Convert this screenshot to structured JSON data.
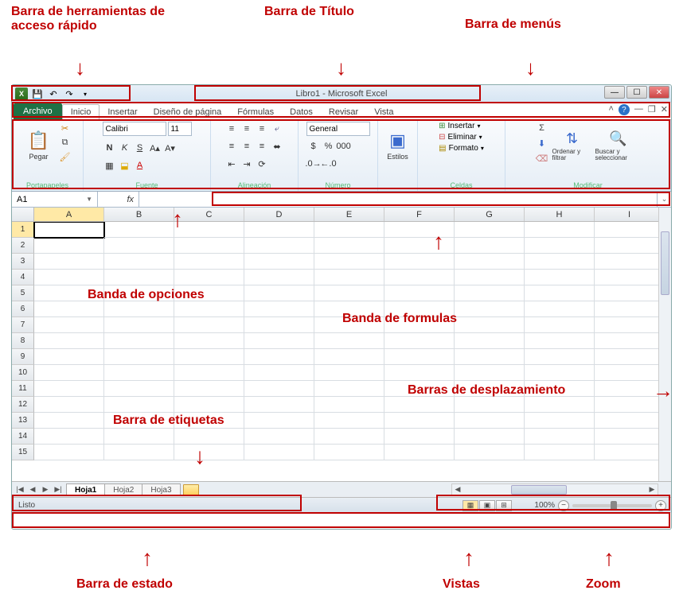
{
  "annotations": {
    "qat": "Barra de herramientas de acceso rápido",
    "title": "Barra de Título",
    "menus": "Barra de menús",
    "ribbon": "Banda de opciones",
    "formula": "Banda de formulas",
    "scroll": "Barras de desplazamiento",
    "tabs": "Barra de etiquetas",
    "status": "Barra de estado",
    "views": "Vistas",
    "zoom": "Zoom"
  },
  "titlebar": {
    "title": "Libro1  -  Microsoft Excel"
  },
  "menubar": {
    "file": "Archivo",
    "tabs": [
      "Inicio",
      "Insertar",
      "Diseño de página",
      "Fórmulas",
      "Datos",
      "Revisar",
      "Vista"
    ]
  },
  "ribbon": {
    "clipboard": {
      "label": "Portapapeles",
      "paste": "Pegar"
    },
    "font": {
      "label": "Fuente",
      "name": "Calibri",
      "size": "11"
    },
    "alignment": {
      "label": "Alineación"
    },
    "number": {
      "label": "Número",
      "format": "General"
    },
    "styles": {
      "label": "",
      "btn": "Estilos"
    },
    "cells": {
      "label": "Celdas",
      "insert": "Insertar",
      "delete": "Eliminar",
      "format": "Formato"
    },
    "editing": {
      "label": "Modificar",
      "sort": "Ordenar y filtrar",
      "find": "Buscar y seleccionar"
    }
  },
  "namebox": "A1",
  "fx": "fx",
  "columns": [
    "A",
    "B",
    "C",
    "D",
    "E",
    "F",
    "G",
    "H",
    "I"
  ],
  "rows": [
    "1",
    "2",
    "3",
    "4",
    "5",
    "6",
    "7",
    "8",
    "9",
    "10",
    "11",
    "12",
    "13",
    "14",
    "15"
  ],
  "sheets": {
    "active": "Hoja1",
    "others": [
      "Hoja2",
      "Hoja3"
    ]
  },
  "status": {
    "ready": "Listo",
    "zoom": "100%"
  }
}
